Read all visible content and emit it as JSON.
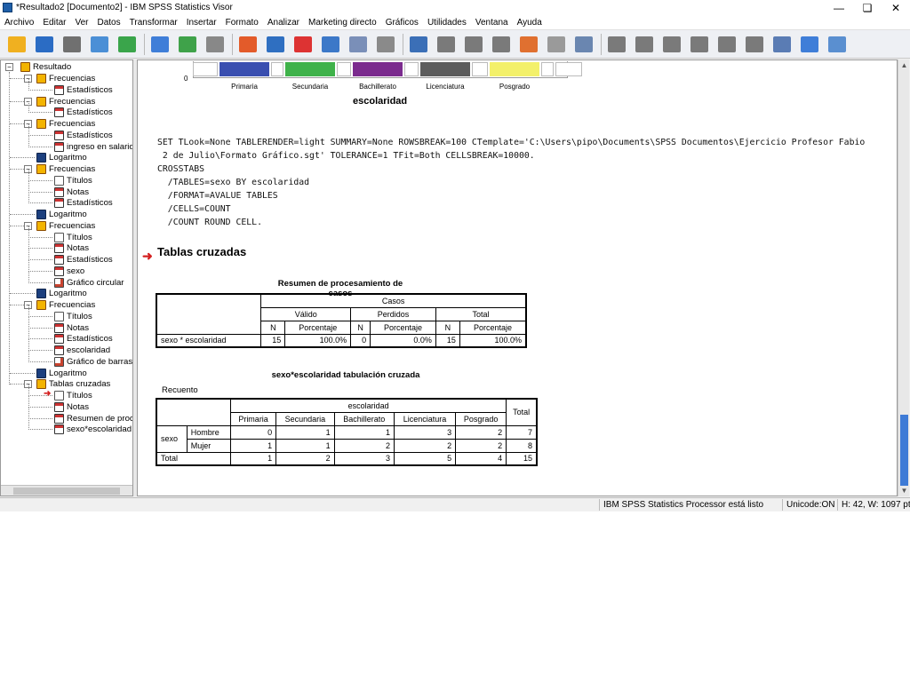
{
  "window": {
    "title": "*Resultado2 [Documento2] - IBM SPSS Statistics Visor"
  },
  "menu": [
    "Archivo",
    "Editar",
    "Ver",
    "Datos",
    "Transformar",
    "Insertar",
    "Formato",
    "Analizar",
    "Marketing directo",
    "Gráficos",
    "Utilidades",
    "Ventana",
    "Ayuda"
  ],
  "toolbar": {
    "icons": [
      "open-icon",
      "save-icon",
      "print-icon",
      "print-preview-icon",
      "export-icon",
      "go-to-data-icon",
      "undo-icon",
      "redo-icon",
      "variables-icon",
      "case-icon",
      "insert-output-icon",
      "select-cases-icon",
      "value-labels-icon",
      "sets-icon",
      "designate-window-icon",
      "promote-icon",
      "demote-icon",
      "show-all-icon",
      "hide-icon",
      "collapse-icon",
      "expand-icon",
      "back-icon",
      "forward-icon",
      "add-icon",
      "remove-icon",
      "show-icon",
      "hide-output-icon",
      "insert-heading-icon",
      "insert-title-icon",
      "insert-text-icon"
    ]
  },
  "tree": {
    "root": "Resultado",
    "items": [
      {
        "label": "Frecuencias",
        "level": 1,
        "icon": "book"
      },
      {
        "label": "Estadísticos",
        "level": 2,
        "icon": "table"
      },
      {
        "label": "Frecuencias",
        "level": 1,
        "icon": "book"
      },
      {
        "label": "Estadísticos",
        "level": 2,
        "icon": "table"
      },
      {
        "label": "Frecuencias",
        "level": 1,
        "icon": "book"
      },
      {
        "label": "Estadísticos",
        "level": 2,
        "icon": "table"
      },
      {
        "label": "ingreso en salario",
        "level": 2,
        "icon": "table"
      },
      {
        "label": "Logaritmo",
        "level": 1,
        "icon": "log"
      },
      {
        "label": "Frecuencias",
        "level": 1,
        "icon": "book"
      },
      {
        "label": "Títulos",
        "level": 2,
        "icon": "page"
      },
      {
        "label": "Notas",
        "level": 2,
        "icon": "table"
      },
      {
        "label": "Estadísticos",
        "level": 2,
        "icon": "table"
      },
      {
        "label": "Logaritmo",
        "level": 1,
        "icon": "log"
      },
      {
        "label": "Frecuencias",
        "level": 1,
        "icon": "book"
      },
      {
        "label": "Títulos",
        "level": 2,
        "icon": "page"
      },
      {
        "label": "Notas",
        "level": 2,
        "icon": "table"
      },
      {
        "label": "Estadísticos",
        "level": 2,
        "icon": "table"
      },
      {
        "label": "sexo",
        "level": 2,
        "icon": "table"
      },
      {
        "label": "Gráfico circular",
        "level": 2,
        "icon": "chart"
      },
      {
        "label": "Logaritmo",
        "level": 1,
        "icon": "log"
      },
      {
        "label": "Frecuencias",
        "level": 1,
        "icon": "book"
      },
      {
        "label": "Títulos",
        "level": 2,
        "icon": "page"
      },
      {
        "label": "Notas",
        "level": 2,
        "icon": "table"
      },
      {
        "label": "Estadísticos",
        "level": 2,
        "icon": "table"
      },
      {
        "label": "escolaridad",
        "level": 2,
        "icon": "table"
      },
      {
        "label": "Gráfico de barras",
        "level": 2,
        "icon": "chart"
      },
      {
        "label": "Logaritmo",
        "level": 1,
        "icon": "log"
      },
      {
        "label": "Tablas cruzadas",
        "level": 1,
        "icon": "book"
      },
      {
        "label": "Títulos",
        "level": 2,
        "icon": "page",
        "current": true
      },
      {
        "label": "Notas",
        "level": 2,
        "icon": "table"
      },
      {
        "label": "Resumen de proc",
        "level": 2,
        "icon": "table"
      },
      {
        "label": "sexo*escolaridad",
        "level": 2,
        "icon": "table"
      }
    ]
  },
  "chart": {
    "axis_zero": "0",
    "legend": [
      {
        "label": "Primaria",
        "color": "#3a4fb0"
      },
      {
        "label": "Secundaria",
        "color": "#3fb24a"
      },
      {
        "label": "Bachillerato",
        "color": "#7b2b8e"
      },
      {
        "label": "Licenciatura",
        "color": "#5c5c5c"
      },
      {
        "label": "Posgrado",
        "color": "#f3f06a"
      }
    ],
    "xlabel": "escolaridad"
  },
  "syntax": "SET TLook=None TABLERENDER=light SUMMARY=None ROWSBREAK=100 CTemplate='C:\\Users\\pipo\\Documents\\SPSS Documentos\\Ejercicio Profesor Fabio\n 2 de Julio\\Formato Gráfico.sgt' TOLERANCE=1 TFit=Both CELLSBREAK=10000.\nCROSSTABS\n  /TABLES=sexo BY escolaridad\n  /FORMAT=AVALUE TABLES\n  /CELLS=COUNT\n  /COUNT ROUND CELL.",
  "section_title": "Tablas cruzadas",
  "summary": {
    "title": "Resumen de procesamiento de casos",
    "casos": "Casos",
    "groups": [
      "Válido",
      "Perdidos",
      "Total"
    ],
    "sub": [
      "N",
      "Porcentaje",
      "N",
      "Porcentaje",
      "N",
      "Porcentaje"
    ],
    "row_label": "sexo * escolaridad",
    "values": [
      "15",
      "100.0%",
      "0",
      "0.0%",
      "15",
      "100.0%"
    ]
  },
  "crosstab": {
    "title": "sexo*escolaridad tabulación cruzada",
    "count_label": "Recuento",
    "col_var": "escolaridad",
    "cols": [
      "Primaria",
      "Secundaria",
      "Bachillerato",
      "Licenciatura",
      "Posgrado"
    ],
    "total_label": "Total",
    "row_var": "sexo",
    "rows": [
      {
        "label": "Hombre",
        "values": [
          "0",
          "1",
          "1",
          "3",
          "2"
        ],
        "total": "7"
      },
      {
        "label": "Mujer",
        "values": [
          "1",
          "1",
          "2",
          "2",
          "2"
        ],
        "total": "8"
      }
    ],
    "totals": [
      "1",
      "2",
      "3",
      "5",
      "4"
    ],
    "grand_total": "15"
  },
  "status": {
    "processor": "IBM SPSS Statistics Processor está listo",
    "unicode": "Unicode:ON",
    "size": "H: 42, W: 1097 pt."
  }
}
